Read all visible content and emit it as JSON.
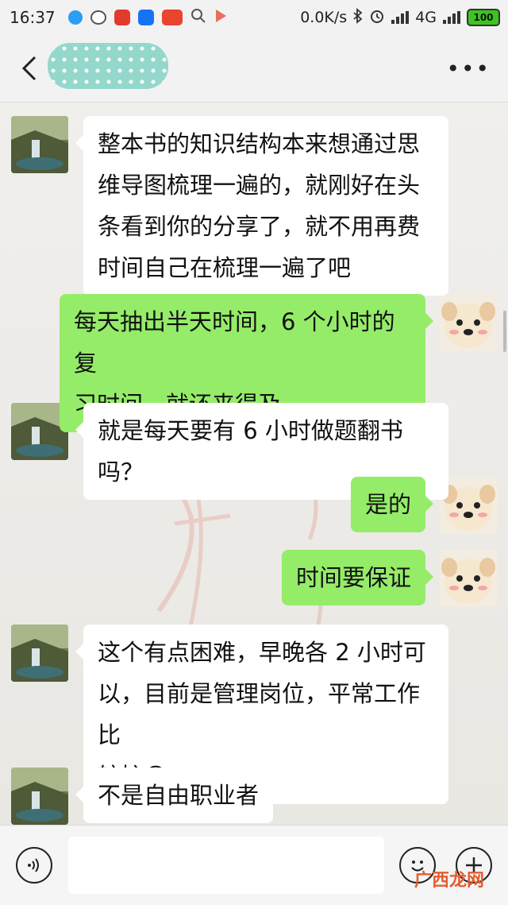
{
  "status_bar": {
    "time": "16:37",
    "net_speed": "0.0K/s",
    "network": "4G",
    "battery": "100",
    "colors": {
      "battery_fill": "#3cc51f"
    },
    "icons": [
      "app-blue-icon",
      "wechat-icon",
      "app-red-icon",
      "zhihu-icon",
      "app-lottery-icon",
      "search-icon",
      "play-icon",
      "bluetooth-icon",
      "alarm-icon",
      "signal-icon"
    ]
  },
  "header": {
    "back_icon": "chevron-left-icon",
    "more_label": "•••"
  },
  "messages": [
    {
      "side": "left",
      "text": [
        "整本书的知识结构本来想通过思",
        "维导图梳理一遍的，就刚好在头",
        "条看到你的分享了，就不用再费",
        "时间自己在梳理一遍了吧"
      ]
    },
    {
      "side": "right",
      "text": [
        "每天抽出半天时间，6 个小时的复",
        "习时间，就还来得及"
      ]
    },
    {
      "side": "left",
      "text": [
        "就是每天要有 6 小时做题翻书吗？"
      ]
    },
    {
      "side": "right",
      "text": [
        "是的"
      ]
    },
    {
      "side": "right",
      "text": [
        "时间要保证"
      ]
    },
    {
      "side": "left",
      "text": [
        "这个有点困难，早晚各 2 小时可",
        "以，目前是管理岗位，平常工作比",
        "较忙😏"
      ]
    },
    {
      "side": "left",
      "text": [
        "不是自由职业者"
      ]
    }
  ],
  "input": {
    "placeholder": ""
  },
  "site_watermark": "广西龙网",
  "colors": {
    "bubble_self": "#95ec69",
    "bubble_other": "#ffffff",
    "background": "#efefed"
  }
}
